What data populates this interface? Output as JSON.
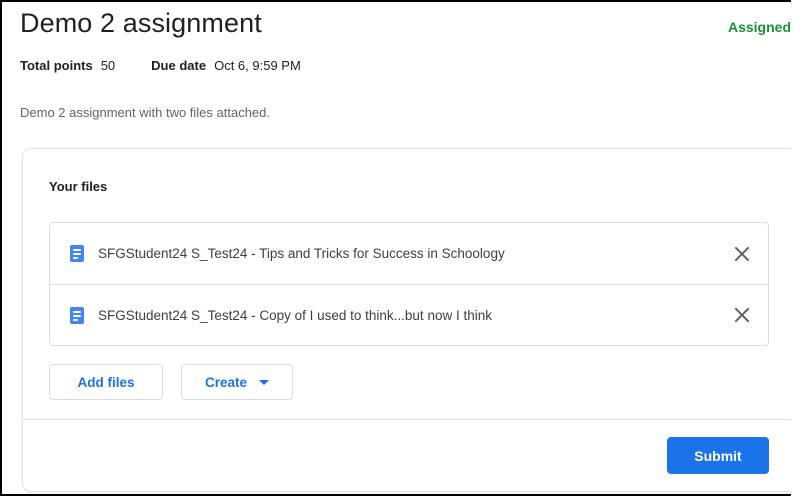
{
  "assignment": {
    "title": "Demo 2 assignment",
    "status": "Assigned",
    "status_color": "#1e8e3e",
    "total_points_label": "Total points",
    "total_points_value": "50",
    "due_date_label": "Due date",
    "due_date_value": "Oct 6, 9:59 PM",
    "description": "Demo 2 assignment with two files attached."
  },
  "work_card": {
    "heading": "Your files",
    "files": [
      {
        "icon": "google-docs-icon",
        "name": "SFGStudent24 S_Test24 - Tips and Tricks for Success in Schoology",
        "remove_icon": "close-icon"
      },
      {
        "icon": "google-docs-icon",
        "name": "SFGStudent24 S_Test24 - Copy of I used to think...but now I think",
        "remove_icon": "close-icon"
      }
    ],
    "add_files_label": "Add files",
    "create_label": "Create",
    "create_icon": "caret-down-icon",
    "submit_label": "Submit"
  },
  "colors": {
    "accent": "#1a73e8",
    "doc_icon": "#4285f4"
  }
}
